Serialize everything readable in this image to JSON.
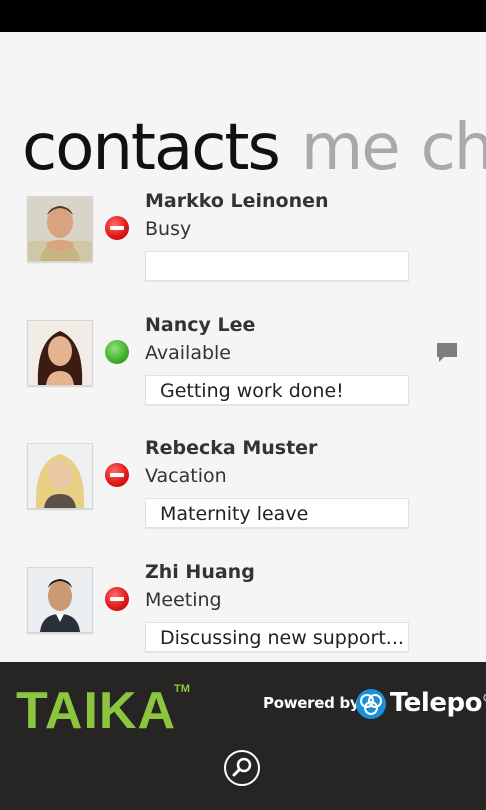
{
  "pivot": {
    "items": [
      "contacts",
      "me",
      "chat"
    ]
  },
  "contacts": [
    {
      "name": "Markko Leinonen",
      "status": "Busy",
      "status_kind": "busy",
      "note": "",
      "chat": false
    },
    {
      "name": "Nancy Lee",
      "status": "Available",
      "status_kind": "available",
      "note": "Getting work done!",
      "chat": true
    },
    {
      "name": "Rebecka Muster",
      "status": "Vacation",
      "status_kind": "busy",
      "note": "Maternity leave",
      "chat": false
    },
    {
      "name": "Zhi Huang",
      "status": "Meeting",
      "status_kind": "busy",
      "note": "Discussing new support...",
      "chat": false
    }
  ],
  "footer": {
    "brand": "TAIKA",
    "trademark": "TM",
    "powered_by": "Powered by",
    "partner": "Telepo",
    "registered": "®"
  },
  "colors": {
    "brand_green": "#8cc63f",
    "busy": "#e21a1a",
    "available": "#3fae2a",
    "footer_bg": "#262524"
  },
  "icons": {
    "search": "search-icon",
    "chat": "chat-bubble-icon",
    "busy": "busy-status-icon",
    "available": "available-status-icon"
  }
}
